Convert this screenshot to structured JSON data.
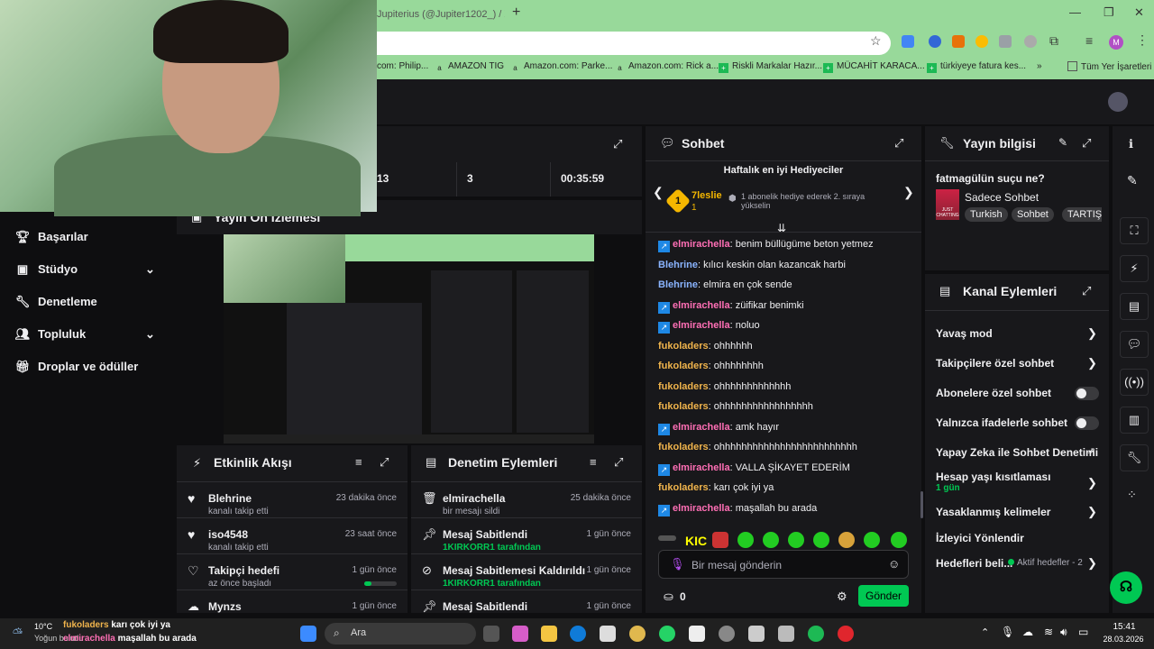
{
  "browser": {
    "tab_title": "Jupiterius (@Jupiter1202_) / X",
    "avatar_letter": "M",
    "bookmarks": [
      {
        "label": "com: Philip...",
        "icon": "bookmark-icon"
      },
      {
        "label": "AMAZON TIG",
        "icon": "amazon-icon"
      },
      {
        "label": "Amazon.com: Parke...",
        "icon": "amazon-icon"
      },
      {
        "label": "Amazon.com: Rick a...",
        "icon": "amazon-icon"
      },
      {
        "label": "Riskli Markalar Hazır...",
        "icon": "plus-green-icon"
      },
      {
        "label": "MÜCAHİT KARACA...",
        "icon": "plus-green-icon"
      },
      {
        "label": "türkiyeye fatura kes...",
        "icon": "plus-green-icon"
      }
    ],
    "bookmarks_more": "»",
    "all_bookmarks": "Tüm Yer İşaretleri"
  },
  "sidebar": {
    "items": [
      {
        "label": "Başarılar",
        "icon": "trophy-icon"
      },
      {
        "label": "Stüdyo",
        "icon": "studio-icon",
        "chevron": true
      },
      {
        "label": "Denetleme",
        "icon": "wrench-icon"
      },
      {
        "label": "Topluluk",
        "icon": "people-icon",
        "chevron": true
      },
      {
        "label": "Droplar ve ödüller",
        "icon": "gift-icon"
      }
    ]
  },
  "stats": {
    "values": [
      "13",
      "3",
      "00:35:59"
    ]
  },
  "preview": {
    "title": "Yayın Ön İzlemesi"
  },
  "activity": {
    "title": "Etkinlik Akışı",
    "items": [
      {
        "name": "Blehrine",
        "sub": "kanalı takip etti",
        "time": "23 dakika önce",
        "icon": "heart-icon"
      },
      {
        "name": "iso4548",
        "sub": "kanalı takip etti",
        "time": "23 saat önce",
        "icon": "heart-icon"
      },
      {
        "name": "Takipçi hedefi",
        "sub": "az önce başladı",
        "time": "1 gün önce",
        "icon": "heart-outline-icon"
      },
      {
        "name": "Mynzs",
        "sub": "",
        "time": "1 gün önce",
        "icon": "cloud-icon"
      }
    ]
  },
  "moderation": {
    "title": "Denetim Eylemleri",
    "items": [
      {
        "name": "elmirachella",
        "sub": "bir mesajı sildi",
        "time": "25 dakika önce",
        "icon": "trash-icon"
      },
      {
        "name": "Mesaj Sabitlendi",
        "sub": "1KIRKORR1 tarafından",
        "time": "1 gün önce",
        "icon": "pin-icon"
      },
      {
        "name": "Mesaj Sabitlemesi Kaldırıldı",
        "sub": "1KIRKORR1 tarafından",
        "time": "1 gün önce",
        "icon": "unpin-icon"
      },
      {
        "name": "Mesaj Sabitlendi",
        "sub": "",
        "time": "1 gün önce",
        "icon": "pin-icon"
      }
    ]
  },
  "chat": {
    "title": "Sohbet",
    "leaderboard_title": "Haftalık en iyi Hediyeciler",
    "top_gifter": "7leslie",
    "top_rank": "1",
    "top_count": "1",
    "gift_hint": "1 abonelik hediye ederek 2. sıraya yükselin",
    "messages": [
      {
        "user": "elmirachella",
        "color": "pink",
        "badge": true,
        "text": "benim büllügüme beton yetmez"
      },
      {
        "user": "Blehrine",
        "color": "blue",
        "badge": false,
        "text": "kılıcı keskin olan kazancak harbi"
      },
      {
        "user": "Blehrine",
        "color": "blue",
        "badge": false,
        "text": "elmira en çok sende"
      },
      {
        "user": "elmirachella",
        "color": "pink",
        "badge": true,
        "text": "züifikar benimki"
      },
      {
        "user": "elmirachella",
        "color": "pink",
        "badge": true,
        "text": "noluo"
      },
      {
        "user": "fukoladers",
        "color": "gold",
        "badge": false,
        "text": "ohhhhhh"
      },
      {
        "user": "fukoladers",
        "color": "gold",
        "badge": false,
        "text": "ohhhhhhhh"
      },
      {
        "user": "fukoladers",
        "color": "gold",
        "badge": false,
        "text": "ohhhhhhhhhhhhh"
      },
      {
        "user": "fukoladers",
        "color": "gold",
        "badge": false,
        "text": "ohhhhhhhhhhhhhhhhh"
      },
      {
        "user": "elmirachella",
        "color": "pink",
        "badge": true,
        "text": "amk hayır"
      },
      {
        "user": "fukoladers",
        "color": "gold",
        "badge": false,
        "text": "ohhhhhhhhhhhhhhhhhhhhhhhhh"
      },
      {
        "user": "elmirachella",
        "color": "pink",
        "badge": true,
        "text": "VALLA ŞİKAYET EDERİM"
      },
      {
        "user": "fukoladers",
        "color": "gold",
        "badge": false,
        "text": "karı çok iyi ya"
      },
      {
        "user": "elmirachella",
        "color": "pink",
        "badge": true,
        "text": "maşallah bu arada"
      }
    ],
    "emote_first": "KIC",
    "input_placeholder": "Bir mesaj gönderin",
    "points": "0",
    "send_label": "Gönder"
  },
  "stream_info": {
    "title": "Yayın bilgisi",
    "stream_title": "fatmagülün suçu ne?",
    "category": "Sadece Sohbet",
    "category_art_text": "JUST CHATTING",
    "tags": [
      "Turkish",
      "Sohbet",
      "TARTIŞ"
    ]
  },
  "channel_actions": {
    "title": "Kanal Eylemleri",
    "items": [
      {
        "label": "Yavaş mod",
        "control": "chevron"
      },
      {
        "label": "Takipçilere özel sohbet",
        "control": "chevron"
      },
      {
        "label": "Abonelere özel sohbet",
        "control": "toggle",
        "on": false
      },
      {
        "label": "Yalnızca ifadelerle sohbet",
        "control": "toggle",
        "on": false
      },
      {
        "label": "Yapay Zeka ile Sohbet Denetimi",
        "control": "external"
      },
      {
        "label": "Hesap yaşı kısıtlaması",
        "sub": "1 gün",
        "control": "chevron"
      },
      {
        "label": "Yasaklanmış kelimeler",
        "control": "chevron"
      },
      {
        "label": "İzleyici Yönlendir",
        "control": "none"
      },
      {
        "label": "Hedefleri beli...",
        "sub_inline": "Aktif hedefler - 2",
        "control": "chevron"
      }
    ]
  },
  "overlay": {
    "lines": [
      {
        "user": "fukoladers",
        "text": "karı çok iyi ya"
      },
      {
        "user": "elmirachella",
        "text": "maşallah bu arada"
      }
    ]
  },
  "taskbar": {
    "weather_temp": "10°C",
    "weather_desc": "Yoğun bulutlu",
    "search_label": "Ara",
    "time": "15:41",
    "date": "28.03.2026"
  },
  "colors": {
    "accent": "#00c853",
    "chrome_green": "#98d99a",
    "panel": "#18181b",
    "background": "#0e0e10"
  }
}
